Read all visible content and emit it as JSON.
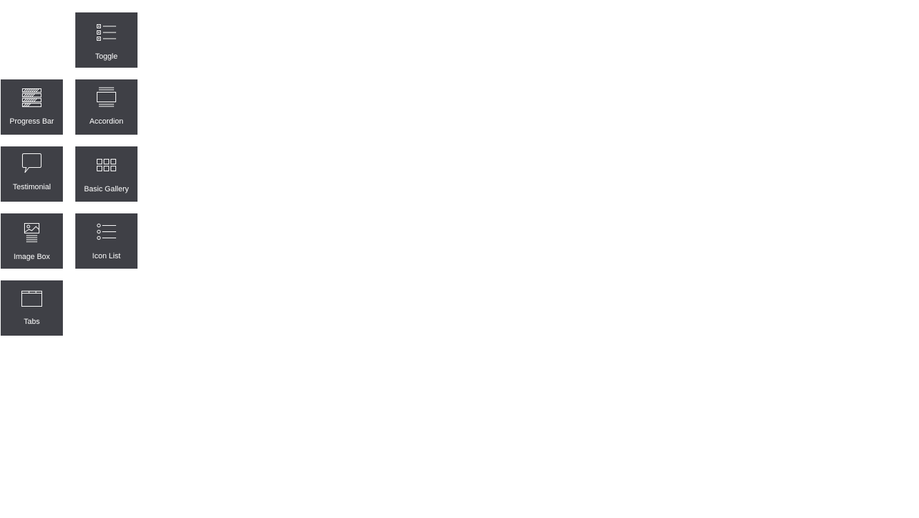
{
  "colors": {
    "page_background": "#ffffff",
    "tile_background": "#3f4046",
    "tile_text": "#ffffff",
    "icon_stroke": "#ffffff"
  },
  "widgets": [
    {
      "id": "toggle",
      "label": "Toggle",
      "icon": "toggle-icon"
    },
    {
      "id": "progress-bar",
      "label": "Progress Bar",
      "icon": "progress-bar-icon"
    },
    {
      "id": "accordion",
      "label": "Accordion",
      "icon": "accordion-icon"
    },
    {
      "id": "testimonial",
      "label": "Testimonial",
      "icon": "testimonial-icon"
    },
    {
      "id": "basic-gallery",
      "label": "Basic Gallery",
      "icon": "gallery-icon"
    },
    {
      "id": "image-box",
      "label": "Image Box",
      "icon": "image-box-icon"
    },
    {
      "id": "icon-list",
      "label": "Icon List",
      "icon": "icon-list-icon"
    },
    {
      "id": "tabs",
      "label": "Tabs",
      "icon": "tabs-icon"
    }
  ]
}
